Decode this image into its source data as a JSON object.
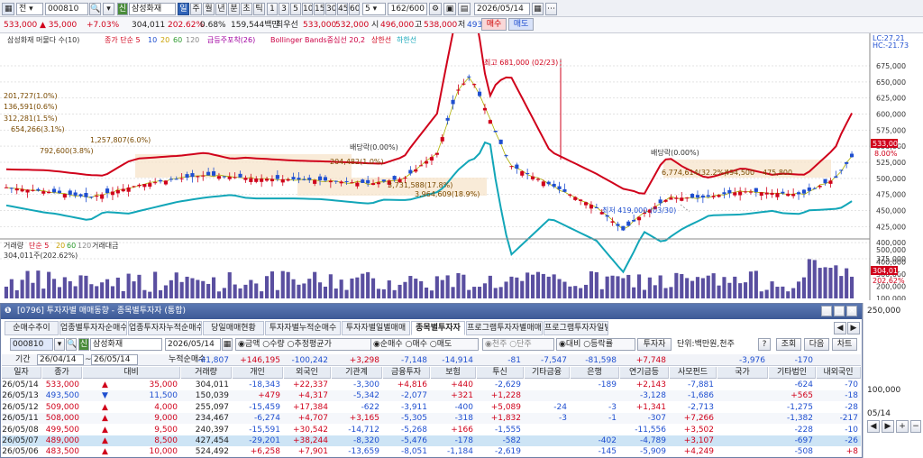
{
  "toolbar1": {
    "window_icon": "grid-icon",
    "market": "전",
    "code": "000810",
    "search_icon": "magnifier-icon",
    "badge": "신",
    "name": "삼성화재",
    "period_buttons": [
      "일",
      "주",
      "월",
      "년",
      "분",
      "초",
      "틱"
    ],
    "active_period": "일",
    "interval_buttons": [
      "1",
      "3",
      "5",
      "10",
      "15",
      "30",
      "45",
      "60"
    ],
    "count_value": "5",
    "range": "162/600",
    "date": "2026/05/14"
  },
  "toolbar2": {
    "price": "533,000",
    "change": "▲ 35,000",
    "change_pct": "+7.03%",
    "volume": "304,011",
    "vol_pct": "202.62%",
    "turnover_pct": "0.68%",
    "amount": "159,544백만",
    "hilo_label": "최우선",
    "ask": "533,000",
    "bid": "532,000",
    "open_label": "시",
    "open": "496,000",
    "high_label": "고",
    "high": "538,000",
    "low_label": "저",
    "low": "493,500",
    "buy": "매수",
    "sell": "매도"
  },
  "chart": {
    "legend": {
      "name": "삼성화재 머물다 수(10)",
      "ma": "종가 단순 5",
      "ma_vals": [
        "10",
        "20",
        "60",
        "120"
      ],
      "pattern": "급등주포착(26)",
      "bb": "Bollinger Bands중심선 20,2",
      "upper": "상한선",
      "lower": "하한선"
    },
    "lc": "LC:27.21",
    "hc": "HC:-21.73",
    "price_axis": [
      "675,000",
      "650,000",
      "625,000",
      "600,000",
      "575,000",
      "550,000",
      "525,000",
      "500,000",
      "475,000",
      "450,000",
      "425,000",
      "400,000",
      "375,000"
    ],
    "price_tag": "533,000",
    "pct_tag": "8.00%",
    "ann": {
      "high": "최고 681,000 (02/23)",
      "low": "최저 419,000 (03/30)",
      "div1": "배당락(0.00%)",
      "div2": "배당락(0.00%)",
      "vp": [
        "201,727(1.0%)",
        "136,591(0.6%)",
        "312,281(1.5%)",
        "654,266(3.1%)",
        "1,257,807(6.0%)",
        "792,600(3.8%)",
        "204,482(1.0%)",
        "3,731,588(17.8%)",
        "3,964,609(18.9%)",
        "6,774,614(32.2%)",
        "494,500",
        "475,800"
      ]
    },
    "vol_legend": {
      "label": "거래량",
      "ma": "단순 5",
      "vals": [
        "20",
        "60",
        "120"
      ],
      "amount": "거래대금"
    },
    "vol_now": "304,011주(202.62%)",
    "vol_axis": [
      "500,000",
      "400,000",
      "300,000",
      "200,000",
      "100,000"
    ],
    "vol_tag": "304,011",
    "vol_pct_tag": "202.62%",
    "colors": {
      "candle_up": "#d0021b",
      "candle_down": "#1f4fd0",
      "bb_upper": "#d0021b",
      "bb_lower": "#12a6b8",
      "volume": "#5a4fa0"
    }
  },
  "panel": {
    "title": "[0796] 투자자별 매매동향 - 종목별투자자 (통합)",
    "tabs": [
      "순매수추이",
      "업종별투자자순매수",
      "업종투자자누적순매수",
      "당일매매현황",
      "투자자별누적순매수",
      "투자자별일별매매",
      "종목별투자자",
      "프로그램투자자별매매",
      "프로그램투자자일별"
    ],
    "active_tab": "종목별투자자",
    "controls": {
      "code": "000810",
      "badge": "신",
      "name": "삼성화재",
      "date": "2026/05/14",
      "r_amount": "금액",
      "r_qty": "수량",
      "r_avg": "추정평균가",
      "r_net": "순매수",
      "r_buy": "매수",
      "r_sell": "매도",
      "r_1k": "천주",
      "r_unit": "단주",
      "r_diff": "대비",
      "r_rate": "등락률",
      "investor": "투자자",
      "unit": "단위:백만원,천주",
      "help": "?",
      "search": "조회",
      "next": "다음",
      "chart": "차트"
    },
    "period": {
      "label": "기간",
      "from": "26/04/14",
      "to": "26/05/14",
      "cum": "누적순매수"
    },
    "cum": [
      "-41,807",
      "+146,195",
      "-100,242",
      "+3,298",
      "-7,148",
      "-14,914",
      "-81",
      "-7,547",
      "-81,598",
      "+7,748",
      "",
      "-3,976",
      "-170"
    ],
    "headers": [
      "일자",
      "종가",
      "대비",
      "거래량",
      "개인",
      "외국인",
      "기관계",
      "금융투자",
      "보험",
      "투신",
      "기타금융",
      "은행",
      "연기금등",
      "사모펀드",
      "국가",
      "기타법인",
      "내외국인"
    ],
    "rows": [
      [
        "26/05/14",
        "533,000",
        "▲",
        "35,000",
        "304,011",
        "-18,343",
        "+22,337",
        "-3,300",
        "+4,816",
        "+440",
        "-2,629",
        "",
        "-189",
        "+2,143",
        "-7,881",
        "",
        "-624",
        "-70"
      ],
      [
        "26/05/13",
        "493,500",
        "▼",
        "11,500",
        "150,039",
        "+479",
        "+4,317",
        "-5,342",
        "-2,077",
        "+321",
        "+1,228",
        "",
        "",
        "-3,128",
        "-1,686",
        "",
        "+565",
        "-18"
      ],
      [
        "26/05/12",
        "509,000",
        "▲",
        "4,000",
        "255,097",
        "-15,459",
        "+17,384",
        "-622",
        "-3,911",
        "-400",
        "+5,089",
        "-24",
        "-3",
        "+1,341",
        "-2,713",
        "",
        "-1,275",
        "-28"
      ],
      [
        "26/05/11",
        "508,000",
        "▲",
        "9,000",
        "234,467",
        "-6,274",
        "+4,707",
        "+3,165",
        "-5,305",
        "-318",
        "+1,832",
        "-3",
        "-1",
        "-307",
        "+7,266",
        "",
        "-1,382",
        "-217"
      ],
      [
        "26/05/08",
        "499,500",
        "▲",
        "9,500",
        "240,397",
        "-15,591",
        "+30,542",
        "-14,712",
        "-5,268",
        "+166",
        "-1,555",
        "",
        "",
        "-11,556",
        "+3,502",
        "",
        "-228",
        "-10"
      ],
      [
        "26/05/07",
        "489,000",
        "▲",
        "8,500",
        "427,454",
        "-29,201",
        "+38,244",
        "-8,320",
        "-5,476",
        "-178",
        "-582",
        "",
        "-402",
        "-4,789",
        "+3,107",
        "",
        "-697",
        "-26"
      ],
      [
        "26/05/06",
        "483,500",
        "▲",
        "10,000",
        "524,492",
        "+6,258",
        "+7,901",
        "-13,659",
        "-8,051",
        "-1,184",
        "-2,619",
        "",
        "-145",
        "-5,909",
        "+4,249",
        "",
        "-508",
        "+8"
      ]
    ]
  },
  "right": {
    "axis": [
      "250,000",
      "100,000"
    ],
    "date": "05/14"
  }
}
